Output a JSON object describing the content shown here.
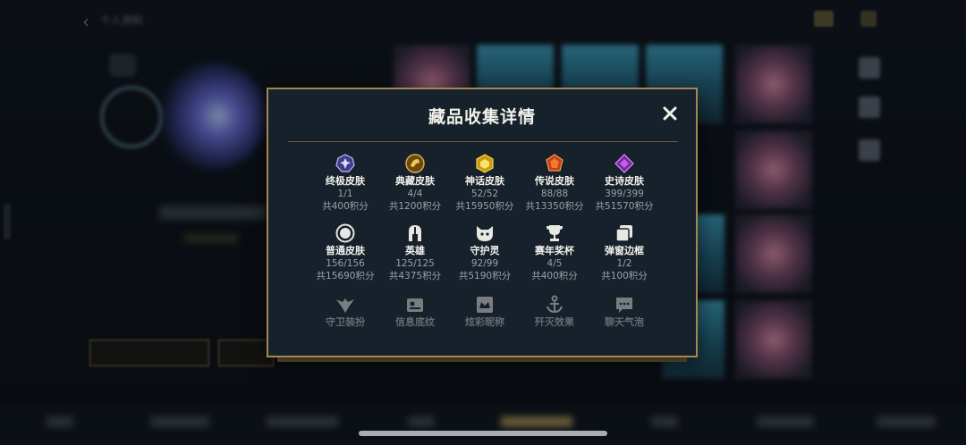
{
  "background": {
    "title": "个人资料"
  },
  "modal": {
    "title": "藏品收集详情",
    "close_icon": "close-icon",
    "items": [
      {
        "icon": "ultimate-skin-icon",
        "name": "终极皮肤",
        "count": "1/1",
        "points": "共400积分"
      },
      {
        "icon": "collector-skin-icon",
        "name": "典藏皮肤",
        "count": "4/4",
        "points": "共1200积分"
      },
      {
        "icon": "mythic-skin-icon",
        "name": "神话皮肤",
        "count": "52/52",
        "points": "共15950积分"
      },
      {
        "icon": "legendary-skin-icon",
        "name": "传说皮肤",
        "count": "88/88",
        "points": "共13350积分"
      },
      {
        "icon": "epic-skin-icon",
        "name": "史诗皮肤",
        "count": "399/399",
        "points": "共51570积分"
      },
      {
        "icon": "normal-skin-icon",
        "name": "普通皮肤",
        "count": "156/156",
        "points": "共15690积分"
      },
      {
        "icon": "champion-helmet-icon",
        "name": "英雄",
        "count": "125/125",
        "points": "共4375积分"
      },
      {
        "icon": "guardian-pet-icon",
        "name": "守护灵",
        "count": "92/99",
        "points": "共5190积分"
      },
      {
        "icon": "trophy-icon",
        "name": "赛年奖杯",
        "count": "4/5",
        "points": "共400积分"
      },
      {
        "icon": "popup-frame-icon",
        "name": "弹窗边框",
        "count": "1/2",
        "points": "共100积分"
      },
      {
        "icon": "guardian-outfit-icon",
        "name": "守卫装扮"
      },
      {
        "icon": "info-pattern-icon",
        "name": "信息底纹"
      },
      {
        "icon": "colorful-title-icon",
        "name": "炫彩昵称"
      },
      {
        "icon": "annihilation-effect-icon",
        "name": "歼灭效果"
      },
      {
        "icon": "chat-bubble-icon",
        "name": "聊天气泡"
      }
    ]
  },
  "colors": {
    "gold_border": "#a4884f",
    "modal_bg": "#17212b",
    "text_primary": "#f3f3ee",
    "text_secondary": "#9aa1a8"
  }
}
